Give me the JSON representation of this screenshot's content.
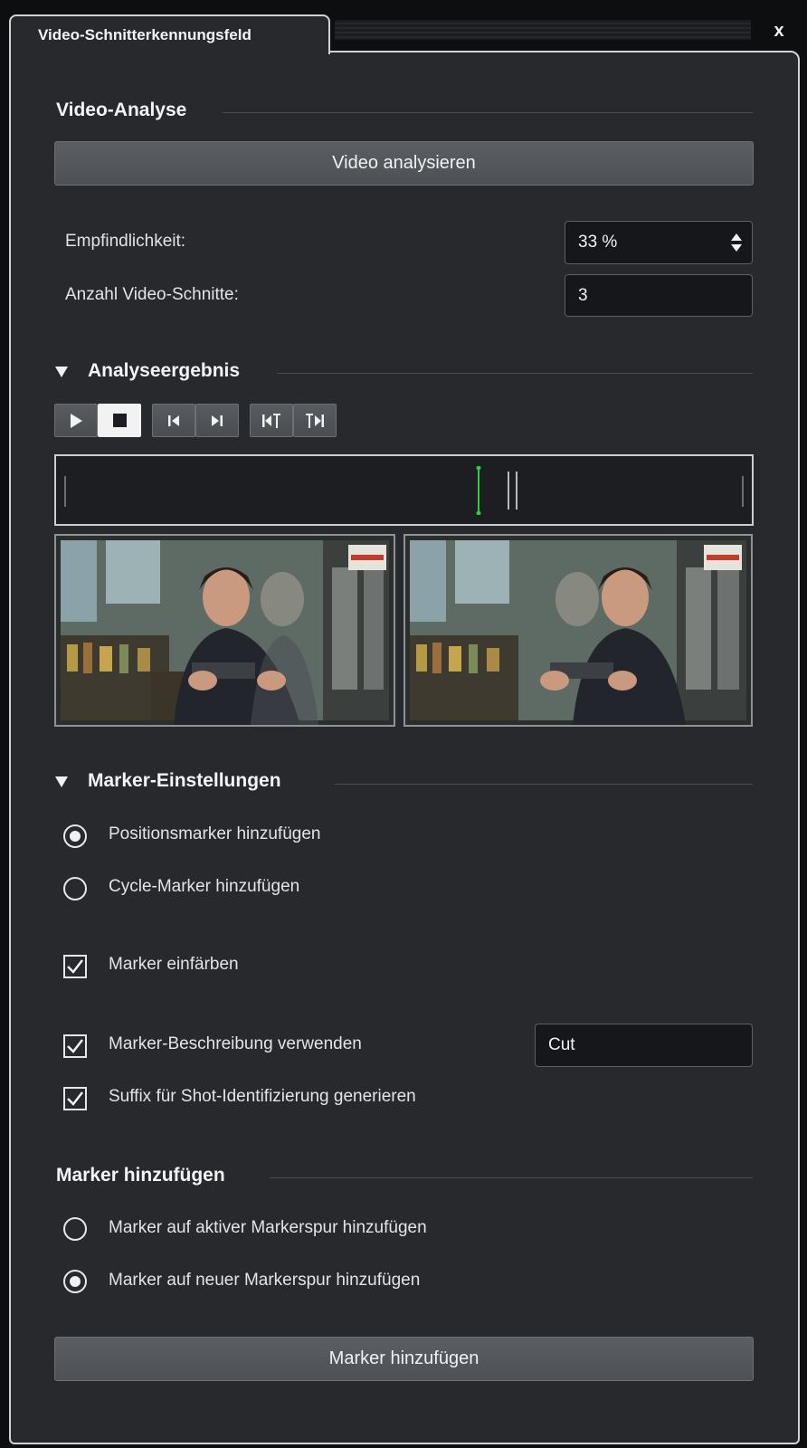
{
  "window": {
    "tab_title": "Video-Schnitterkennungsfeld",
    "close_label": "x"
  },
  "video_analysis": {
    "header": "Video-Analyse",
    "analyze_button": "Video analysieren",
    "sensitivity_label": "Empfindlichkeit:",
    "sensitivity_value": "33 %",
    "cut_count_label": "Anzahl Video-Schnitte:",
    "cut_count_value": "3"
  },
  "analysis_result": {
    "header": "Analyseergebnis",
    "transport": [
      "play-icon",
      "stop-icon",
      "previous-icon",
      "next-icon",
      "go-to-cut-left-icon",
      "go-to-cut-right-icon"
    ],
    "accent_color": "#2ecc40"
  },
  "marker_settings": {
    "header": "Marker-Einstellungen",
    "options": [
      {
        "label": "Positionsmarker hinzufügen",
        "selected": true
      },
      {
        "label": "Cycle-Marker hinzufügen",
        "selected": false
      }
    ],
    "color_markers_label": "Marker einfärben",
    "color_markers_checked": true,
    "description_label": "Marker-Beschreibung verwenden",
    "description_checked": true,
    "description_value": "Cut",
    "suffix_label": "Suffix für Shot-Identifizierung generieren",
    "suffix_checked": true
  },
  "add_markers": {
    "header": "Marker hinzufügen",
    "options": [
      {
        "label": "Marker auf aktiver Markerspur hinzufügen",
        "selected": false
      },
      {
        "label": "Marker auf neuer Markerspur hinzufügen",
        "selected": true
      }
    ],
    "button": "Marker hinzufügen"
  }
}
